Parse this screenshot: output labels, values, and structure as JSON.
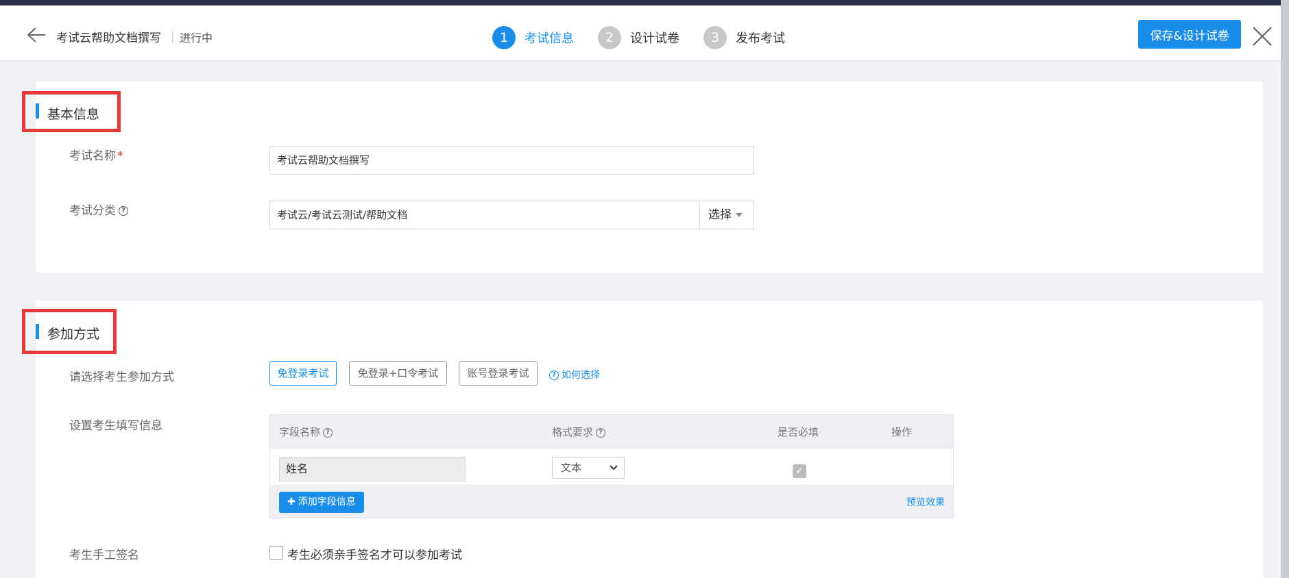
{
  "header": {
    "title": "考试云帮助文档撰写",
    "status": "进行中",
    "steps": [
      {
        "num": "1",
        "label": "考试信息"
      },
      {
        "num": "2",
        "label": "设计试卷"
      },
      {
        "num": "3",
        "label": "发布考试"
      }
    ],
    "save_label": "保存&设计试卷"
  },
  "basic_info": {
    "title": "基本信息",
    "exam_name_label": "考试名称",
    "required_mark": "*",
    "exam_name_value": "考试云帮助文档撰写",
    "category_label": "考试分类",
    "category_value": "考试云/考试云测试/帮助文档",
    "select_label": "选择"
  },
  "join_method": {
    "title": "参加方式",
    "choose_label": "请选择考生参加方式",
    "options": [
      "免登录考试",
      "免登录+口令考试",
      "账号登录考试"
    ],
    "how_to_choose": "如何选择",
    "fields_label": "设置考生填写信息",
    "table": {
      "headers": {
        "field_name": "字段名称",
        "format": "格式要求",
        "required": "是否必填",
        "action": "操作"
      },
      "rows": [
        {
          "field_name": "姓名",
          "format": "文本",
          "required": true
        }
      ],
      "add_label": "添加字段信息",
      "preview_label": "预览效果"
    },
    "signature_label": "考生手工签名",
    "signature_checkbox_label": "考生必须亲手签名才可以参加考试"
  }
}
